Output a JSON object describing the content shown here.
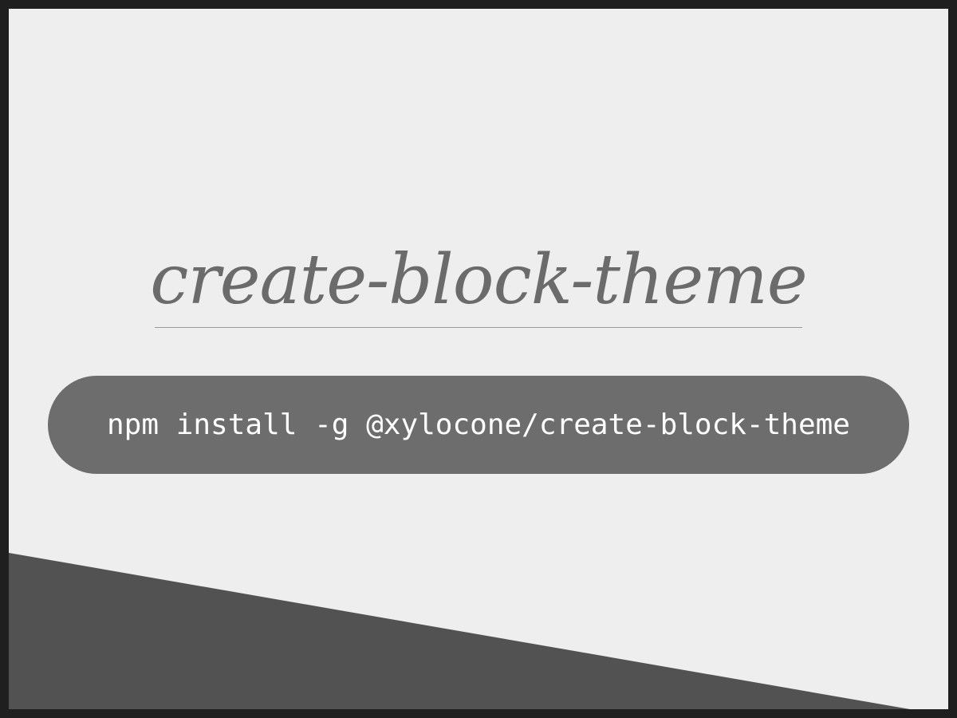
{
  "title": "create-block-theme",
  "command": "npm install -g @xylocone/create-block-theme",
  "colors": {
    "outer_border": "#1f1f1f",
    "background": "#eeeeee",
    "title_text": "#6b6b6b",
    "rule": "#9b9b9b",
    "pill_background": "#6d6d6d",
    "pill_text": "#ffffff",
    "corner_shape": "#525252"
  }
}
